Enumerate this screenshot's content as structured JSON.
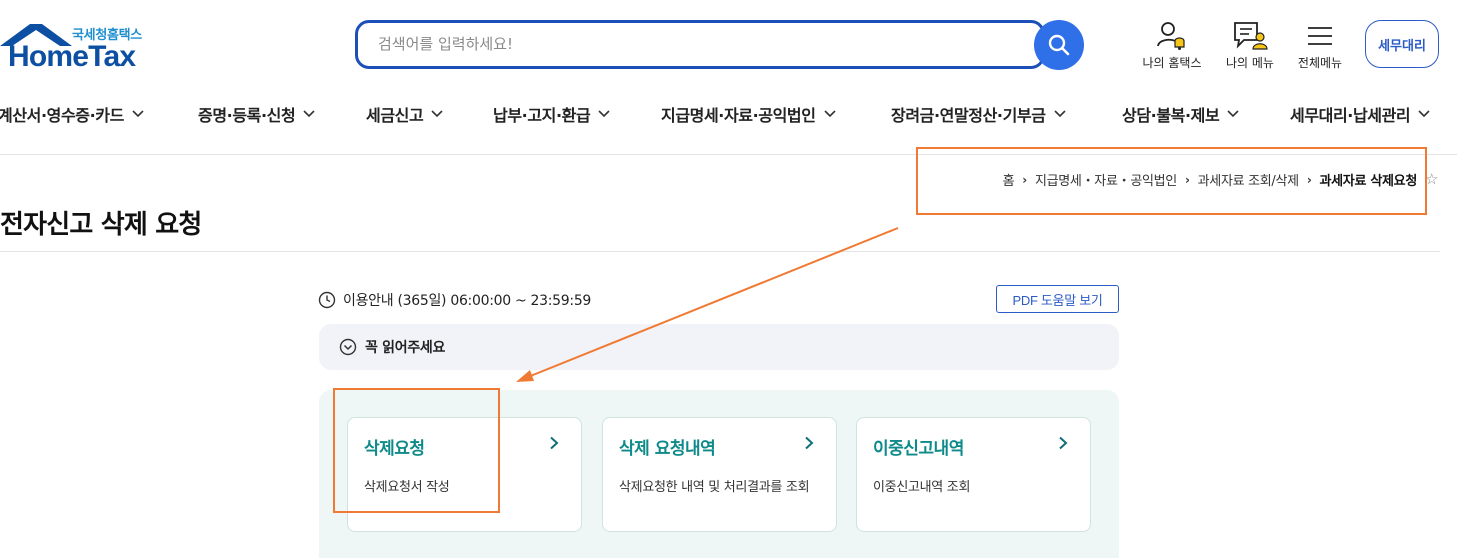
{
  "logo": {
    "korean": "국세청홈택스",
    "english": "HomeTax"
  },
  "search": {
    "placeholder": "검색어를 입력하세요!"
  },
  "utility": [
    {
      "label": "나의 홈택스",
      "icon": "person-bell-icon"
    },
    {
      "label": "나의 메뉴",
      "icon": "menu-person-icon"
    },
    {
      "label": "전체메뉴",
      "icon": "hamburger-icon"
    }
  ],
  "tax_agent_button": "세무대리",
  "nav": [
    "계산서·영수증·카드",
    "증명·등록·신청",
    "세금신고",
    "납부·고지·환급",
    "지급명세·자료·공익법인",
    "장려금·연말정산·기부금",
    "상담·불복·제보",
    "세무대리·납세관리"
  ],
  "breadcrumb": [
    "홈",
    "지급명세・자료・공익법인",
    "과세자료 조회/삭제",
    "과세자료 삭제요청"
  ],
  "page_title": "전자신고 삭제 요청",
  "hours": "이용안내 (365일) 06:00:00 ~ 23:59:59",
  "pdf_button": "PDF 도움말 보기",
  "notice": "꼭 읽어주세요",
  "cards": [
    {
      "title": "삭제요청",
      "desc": "삭제요청서 작성"
    },
    {
      "title": "삭제 요청내역",
      "desc": "삭제요청한 내역 및 처리결과를 조회"
    },
    {
      "title": "이중신고내역",
      "desc": "이중신고내역 조회"
    }
  ],
  "colors": {
    "primary_blue": "#2f6fe8",
    "teal": "#0f8a8a",
    "annotation_orange": "#f07a33"
  }
}
